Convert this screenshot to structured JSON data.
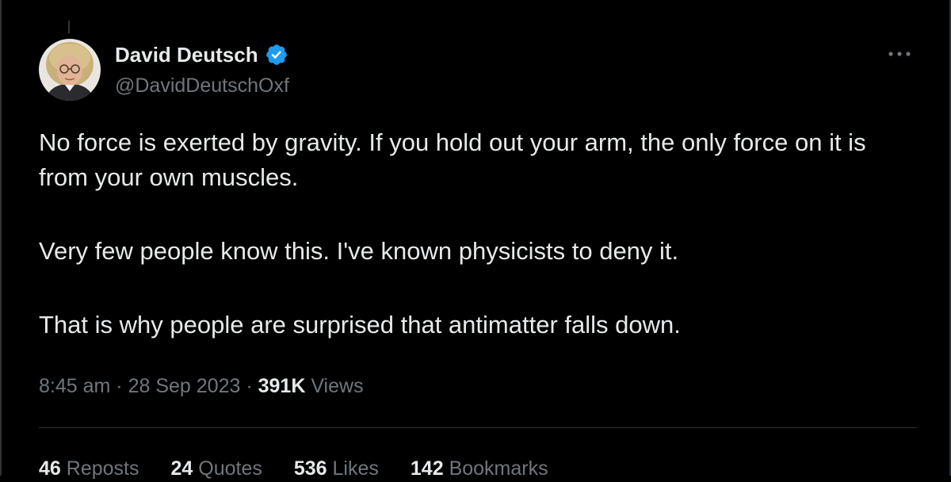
{
  "author": {
    "display_name": "David Deutsch",
    "handle": "@DavidDeutschOxf",
    "verified": true,
    "avatar_icon": "user-avatar-photo"
  },
  "menu": {
    "more_icon": "more-horizontal-icon"
  },
  "tweet": {
    "paragraphs": [
      "No force is exerted by gravity. If you hold out your arm, the only force on it is from your own muscles.",
      "Very few people know this. I've known physicists to deny it.",
      "That is why people are surprised that antimatter falls down."
    ],
    "time": "8:45 am",
    "separator": "·",
    "date": "28 Sep 2023",
    "views_count": "391K",
    "views_label": "Views"
  },
  "stats": [
    {
      "count": "46",
      "label": "Reposts"
    },
    {
      "count": "24",
      "label": "Quotes"
    },
    {
      "count": "536",
      "label": "Likes"
    },
    {
      "count": "142",
      "label": "Bookmarks"
    }
  ],
  "colors": {
    "background": "#000000",
    "text_primary": "#e7e9ea",
    "text_secondary": "#71767b",
    "verified_blue": "#1d9bf0",
    "divider": "#2f3336"
  }
}
